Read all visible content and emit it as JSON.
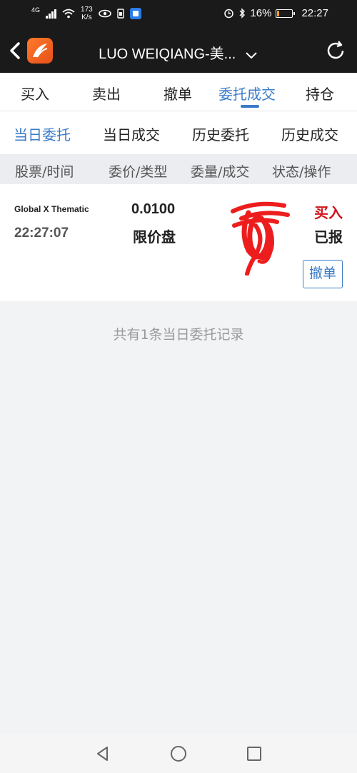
{
  "status_bar": {
    "network": "4G",
    "speed_value": "173",
    "speed_unit": "K/s",
    "battery": "16%",
    "battery_level": 0.16,
    "time": "22:27"
  },
  "nav": {
    "title": "LUO WEIQIANG-美..."
  },
  "main_tabs": [
    {
      "label": "买入"
    },
    {
      "label": "卖出"
    },
    {
      "label": "撤单"
    },
    {
      "label": "委托成交"
    },
    {
      "label": "持仓"
    }
  ],
  "sub_tabs": [
    {
      "label": "当日委托"
    },
    {
      "label": "当日成交"
    },
    {
      "label": "历史委托"
    },
    {
      "label": "历史成交"
    }
  ],
  "columns": [
    {
      "label": "股票/时间"
    },
    {
      "label": "委价/类型"
    },
    {
      "label": "委量/成交"
    },
    {
      "label": "状态/操作"
    }
  ],
  "order": {
    "stock_name": "Global X Thematic",
    "time": "22:27:07",
    "price": "0.0100",
    "order_type": "限价盘",
    "side": "买入",
    "status": "已报",
    "cancel_label": "撤单"
  },
  "summary": "共有1条当日委托记录",
  "colors": {
    "accent": "#3a7bc8",
    "buy_red": "#d0141c",
    "header_bg": "#1a1a1a"
  }
}
